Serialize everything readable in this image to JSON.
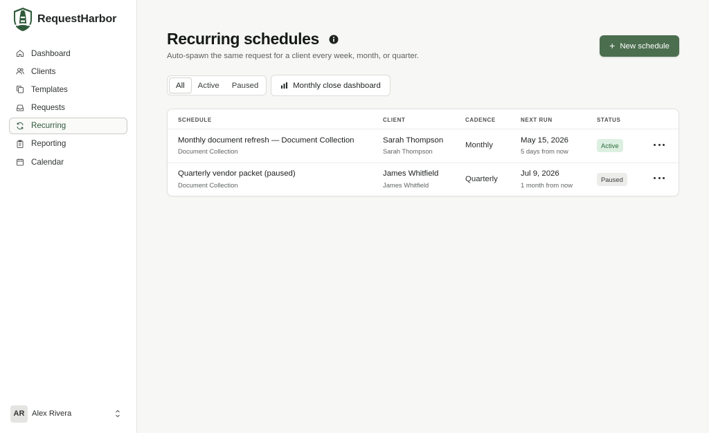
{
  "app": {
    "name": "RequestHarbor"
  },
  "sidebar": {
    "items": [
      {
        "label": "Dashboard",
        "icon": "home-icon"
      },
      {
        "label": "Clients",
        "icon": "users-icon"
      },
      {
        "label": "Templates",
        "icon": "copy-icon"
      },
      {
        "label": "Requests",
        "icon": "inbox-icon"
      },
      {
        "label": "Recurring",
        "icon": "refresh-icon",
        "active": true
      },
      {
        "label": "Reporting",
        "icon": "clipboard-icon"
      },
      {
        "label": "Calendar",
        "icon": "calendar-icon"
      }
    ],
    "user": {
      "initials": "AR",
      "name": "Alex Rivera"
    }
  },
  "page": {
    "title": "Recurring schedules",
    "subtitle": "Auto-spawn the same request for a client every week, month, or quarter.",
    "new_button": "New schedule"
  },
  "filters": {
    "tabs": [
      "All",
      "Active",
      "Paused"
    ],
    "selected": "All",
    "dashboard_button": "Monthly close dashboard"
  },
  "table": {
    "columns": [
      "SCHEDULE",
      "CLIENT",
      "CADENCE",
      "NEXT RUN",
      "STATUS"
    ],
    "rows": [
      {
        "schedule": "Monthly document refresh — Document Collection",
        "template": "Document Collection",
        "client": "Sarah Thompson",
        "client_sub": "Sarah Thompson",
        "cadence": "Monthly",
        "next_run": "May 15, 2026",
        "next_run_rel": "5 days from now",
        "status": "Active"
      },
      {
        "schedule": "Quarterly vendor packet (paused)",
        "template": "Document Collection",
        "client": "James Whitfield",
        "client_sub": "James Whitfield",
        "cadence": "Quarterly",
        "next_run": "Jul 9, 2026",
        "next_run_rel": "1 month from now",
        "status": "Paused"
      }
    ]
  },
  "colors": {
    "brand": "#4b6e4f",
    "active_badge_bg": "#dcefe0",
    "active_badge_text": "#2f6b3d",
    "paused_badge_bg": "#ececeb"
  }
}
